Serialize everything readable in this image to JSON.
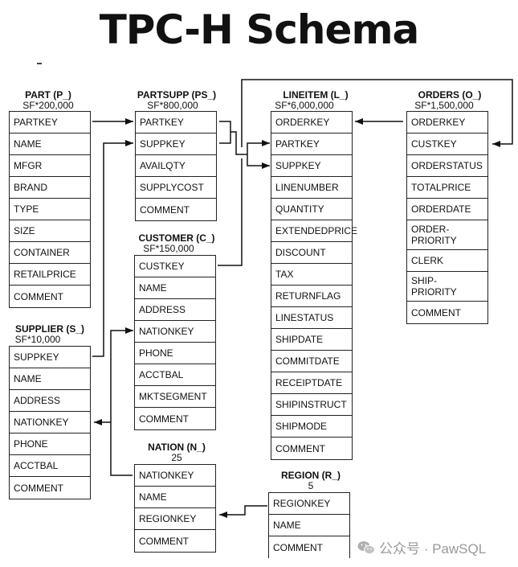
{
  "title": "TPC-H  Schema",
  "tables": {
    "part": {
      "name": "PART (P_)",
      "sf": "SF*200,000",
      "columns": [
        "PARTKEY",
        "NAME",
        "MFGR",
        "BRAND",
        "TYPE",
        "SIZE",
        "CONTAINER",
        "RETAILPRICE",
        "COMMENT"
      ]
    },
    "partsupp": {
      "name": "PARTSUPP (PS_)",
      "sf": "SF*800,000",
      "columns": [
        "PARTKEY",
        "SUPPKEY",
        "AVAILQTY",
        "SUPPLYCOST",
        "COMMENT"
      ]
    },
    "lineitem": {
      "name": "LINEITEM (L_)",
      "sf": "SF*6,000,000",
      "columns": [
        "ORDERKEY",
        "PARTKEY",
        "SUPPKEY",
        "LINENUMBER",
        "QUANTITY",
        "EXTENDEDPRICE",
        "DISCOUNT",
        "TAX",
        "RETURNFLAG",
        "LINESTATUS",
        "SHIPDATE",
        "COMMITDATE",
        "RECEIPTDATE",
        "SHIPINSTRUCT",
        "SHIPMODE",
        "COMMENT"
      ]
    },
    "orders": {
      "name": "ORDERS (O_)",
      "sf": "SF*1,500,000",
      "columns": [
        "ORDERKEY",
        "CUSTKEY",
        "ORDERSTATUS",
        "TOTALPRICE",
        "ORDERDATE",
        "ORDER-\nPRIORITY",
        "CLERK",
        "SHIP-\nPRIORITY",
        "COMMENT"
      ]
    },
    "customer": {
      "name": "CUSTOMER (C_)",
      "sf": "SF*150,000",
      "columns": [
        "CUSTKEY",
        "NAME",
        "ADDRESS",
        "NATIONKEY",
        "PHONE",
        "ACCTBAL",
        "MKTSEGMENT",
        "COMMENT"
      ]
    },
    "supplier": {
      "name": "SUPPLIER (S_)",
      "sf": "SF*10,000",
      "columns": [
        "SUPPKEY",
        "NAME",
        "ADDRESS",
        "NATIONKEY",
        "PHONE",
        "ACCTBAL",
        "COMMENT"
      ]
    },
    "nation": {
      "name": "NATION (N_)",
      "sf": "25",
      "columns": [
        "NATIONKEY",
        "NAME",
        "REGIONKEY",
        "COMMENT"
      ]
    },
    "region": {
      "name": "REGION (R_)",
      "sf": "5",
      "columns": [
        "REGIONKEY",
        "NAME",
        "COMMENT"
      ]
    }
  },
  "relationships": [
    {
      "from": "PART.PARTKEY",
      "to": "PARTSUPP.PARTKEY"
    },
    {
      "from": "SUPPLIER.SUPPKEY",
      "to": "PARTSUPP.SUPPKEY"
    },
    {
      "from": "PARTSUPP.PARTKEY",
      "to": "LINEITEM.PARTKEY"
    },
    {
      "from": "PARTSUPP.SUPPKEY",
      "to": "LINEITEM.SUPPKEY"
    },
    {
      "from": "ORDERS.ORDERKEY",
      "to": "LINEITEM.ORDERKEY"
    },
    {
      "from": "CUSTOMER.CUSTKEY",
      "to": "ORDERS.CUSTKEY"
    },
    {
      "from": "NATION.NATIONKEY",
      "to": "SUPPLIER.NATIONKEY"
    },
    {
      "from": "NATION.NATIONKEY",
      "to": "CUSTOMER.NATIONKEY"
    },
    {
      "from": "REGION.REGIONKEY",
      "to": "NATION.REGIONKEY"
    }
  ],
  "watermark": "公众号 · PawSQL"
}
